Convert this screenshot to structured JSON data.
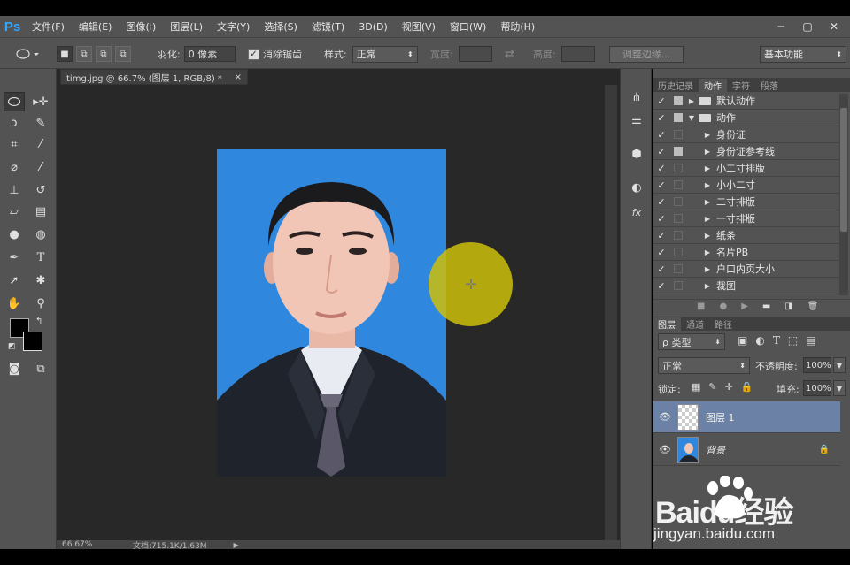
{
  "app": {
    "logo": "Ps"
  },
  "menu": [
    "文件(F)",
    "编辑(E)",
    "图像(I)",
    "图层(L)",
    "文字(Y)",
    "选择(S)",
    "滤镜(T)",
    "3D(D)",
    "视图(V)",
    "窗口(W)",
    "帮助(H)"
  ],
  "window_controls": {
    "minimize": "─",
    "restore": "▢",
    "close": "✕"
  },
  "options": {
    "feather_label": "羽化:",
    "feather_value": "0 像素",
    "antialias_label": "消除锯齿",
    "style_label": "样式:",
    "style_value": "正常",
    "width_label": "宽度:",
    "height_label": "高度:",
    "refine_button": "调整边缘...",
    "workspace": "基本功能"
  },
  "document": {
    "tab_title": "timg.jpg @ 66.7% (图层 1, RGB/8) *",
    "zoom": "66.67%",
    "doc_info": "文档:715.1K/1.63M"
  },
  "history_panel": {
    "tabs": [
      "历史记录",
      "动作",
      "字符",
      "段落"
    ],
    "active_tab": "动作",
    "actions": [
      {
        "label": "默认动作",
        "type": "set",
        "expanded": false
      },
      {
        "label": "动作",
        "type": "set",
        "expanded": true
      },
      {
        "label": "身份证",
        "type": "action"
      },
      {
        "label": "身份证参考线",
        "type": "action"
      },
      {
        "label": "小二寸排版",
        "type": "action"
      },
      {
        "label": "小小二寸",
        "type": "action"
      },
      {
        "label": "二寸排版",
        "type": "action"
      },
      {
        "label": "一寸排版",
        "type": "action"
      },
      {
        "label": "纸条",
        "type": "action"
      },
      {
        "label": "名片PB",
        "type": "action"
      },
      {
        "label": "户口内页大小",
        "type": "action"
      },
      {
        "label": "裁图",
        "type": "action"
      }
    ]
  },
  "layers_panel": {
    "tabs": [
      "图层",
      "通道",
      "路径"
    ],
    "active_tab": "图层",
    "filter_kind": "ρ 类型",
    "blend_mode": "正常",
    "opacity_label": "不透明度:",
    "opacity_value": "100%",
    "lock_label": "锁定:",
    "fill_label": "填充:",
    "fill_value": "100%",
    "layers": [
      {
        "name": "图层 1",
        "selected": true,
        "locked": false
      },
      {
        "name": "背景",
        "selected": false,
        "locked": true
      }
    ]
  },
  "watermark": {
    "logo_text": "Baidu经验",
    "url": "jingyan.baidu.com"
  }
}
